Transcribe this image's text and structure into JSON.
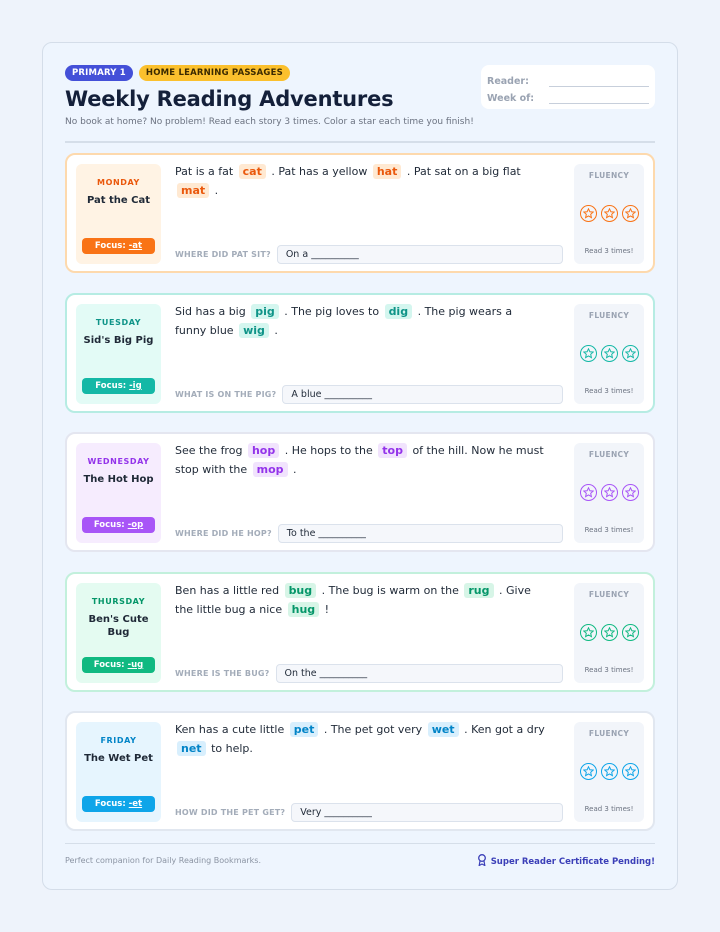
{
  "header": {
    "badge_primary": "PRIMARY 1",
    "badge_topic": "HOME LEARNING PASSAGES",
    "title": "Weekly Reading Adventures",
    "subtitle": "No book at home? No problem! Read each story 3 times. Color a star each time you finish!",
    "reader_label": "Reader:",
    "week_label": "Week of:"
  },
  "days": [
    {
      "day": "MONDAY",
      "title": "Pat the Cat",
      "focus_label": "Focus:",
      "focus_family": "-at",
      "story": [
        {
          "t": "Pat is a fat"
        },
        {
          "w": "cat"
        },
        {
          "t": ". Pat has a yellow"
        },
        {
          "w": "hat"
        },
        {
          "t": ". Pat sat on a big flat"
        },
        {
          "w": "mat"
        },
        {
          "t": "."
        }
      ],
      "question": "WHERE DID PAT SIT?",
      "answer": "On a __________",
      "fluency_label": "FLUENCY",
      "fluency_note": "Read 3 times!",
      "colors": {
        "accent": "#f97316",
        "dark": "#ea580c",
        "label_bg": "#fff3e4",
        "word_bg": "#ffe9d2",
        "border": "#fdd9ad"
      }
    },
    {
      "day": "TUESDAY",
      "title": "Sid's Big Pig",
      "focus_label": "Focus:",
      "focus_family": "-ig",
      "story": [
        {
          "t": "Sid has a big"
        },
        {
          "w": "pig"
        },
        {
          "t": ". The pig loves to"
        },
        {
          "w": "dig"
        },
        {
          "t": ". The pig wears a funny blue"
        },
        {
          "w": "wig"
        },
        {
          "t": "."
        }
      ],
      "question": "WHAT IS ON THE PIG?",
      "answer": "A blue __________",
      "fluency_label": "FLUENCY",
      "fluency_note": "Read 3 times!",
      "colors": {
        "accent": "#14b8a6",
        "dark": "#0f9488",
        "label_bg": "#e3fbf6",
        "word_bg": "#d4f6ef",
        "border": "#b6ece3"
      }
    },
    {
      "day": "WEDNESDAY",
      "title": "The Hot Hop",
      "focus_label": "Focus:",
      "focus_family": "-op",
      "story": [
        {
          "t": "See the frog"
        },
        {
          "w": "hop"
        },
        {
          "t": ". He hops to the"
        },
        {
          "w": "top"
        },
        {
          "t": "of the hill. Now he must stop with the"
        },
        {
          "w": "mop"
        },
        {
          "t": "."
        }
      ],
      "question": "WHERE DID HE HOP?",
      "answer": "To the __________",
      "fluency_label": "FLUENCY",
      "fluency_note": "Read 3 times!",
      "colors": {
        "accent": "#a855f7",
        "dark": "#9333ea",
        "label_bg": "#f6ecfe",
        "word_bg": "#f1e3fd",
        "border": "#e4e6f0"
      }
    },
    {
      "day": "THURSDAY",
      "title": "Ben's Cute Bug",
      "focus_label": "Focus:",
      "focus_family": "-ug",
      "story": [
        {
          "t": "Ben has a little red"
        },
        {
          "w": "bug"
        },
        {
          "t": ". The bug is warm on the"
        },
        {
          "w": "rug"
        },
        {
          "t": ". Give the little bug a nice"
        },
        {
          "w": "hug"
        },
        {
          "t": "!"
        }
      ],
      "question": "WHERE IS THE BUG?",
      "answer": "On the __________",
      "fluency_label": "FLUENCY",
      "fluency_note": "Read 3 times!",
      "colors": {
        "accent": "#10b981",
        "dark": "#059669",
        "label_bg": "#e4fbf1",
        "word_bg": "#d7f5e7",
        "border": "#c2f0dc"
      }
    },
    {
      "day": "FRIDAY",
      "title": "The Wet Pet",
      "focus_label": "Focus:",
      "focus_family": "-et",
      "story": [
        {
          "t": "Ken has a cute little"
        },
        {
          "w": "pet"
        },
        {
          "t": ". The pet got very"
        },
        {
          "w": "wet"
        },
        {
          "t": ". Ken got a dry"
        },
        {
          "w": "net"
        },
        {
          "t": "to help."
        }
      ],
      "question": "HOW DID THE PET GET?",
      "answer": "Very __________",
      "fluency_label": "FLUENCY",
      "fluency_note": "Read 3 times!",
      "colors": {
        "accent": "#0ea5e9",
        "dark": "#0284c7",
        "label_bg": "#e6f5fe",
        "word_bg": "#d8effd",
        "border": "#e1e7f0"
      }
    }
  ],
  "footer": {
    "left": "Perfect companion for Daily Reading Bookmarks.",
    "right": "Super Reader Certificate Pending!",
    "right_icon": "award-ribbon-icon"
  }
}
